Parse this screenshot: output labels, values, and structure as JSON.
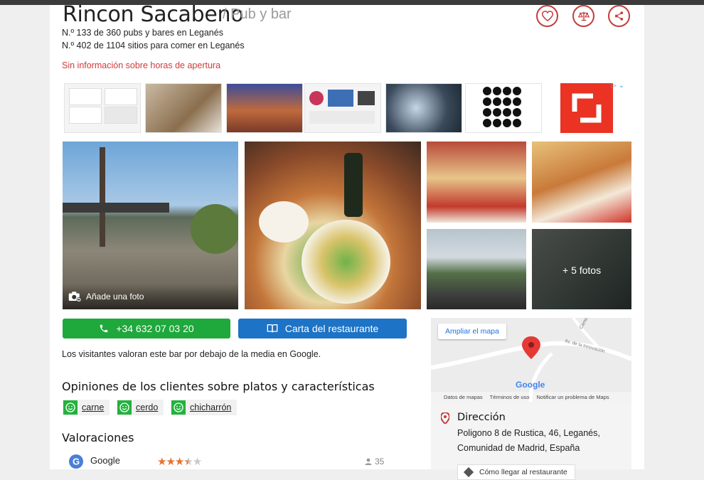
{
  "place": {
    "name": "Rincon Sacabeno",
    "category": "/ Pub y bar",
    "rank_pubs": "N.º 133 de 360 pubs y bares en Leganés",
    "rank_eat": "N.º 402 de 1104 sitios para comer en Leganés",
    "hours_notice": "Sin información sobre horas de apertura"
  },
  "actions": {
    "favorite_icon": "heart-icon",
    "compare_icon": "scale-icon",
    "share_icon": "share-icon"
  },
  "photos": {
    "add_photo": "Añade una foto",
    "more_photos": "+ 5 fotos"
  },
  "buttons": {
    "phone": "+34 632 07 03 20",
    "menu": "Carta del restaurante"
  },
  "visitors_text": "Los visitantes valoran este bar por debajo de la media en Google.",
  "opinions": {
    "heading": "Opiniones de los clientes sobre platos y características",
    "tags": [
      "carne",
      "cerdo",
      "chicharrón"
    ]
  },
  "ratings": {
    "heading": "Valoraciones",
    "rows": [
      {
        "source": "Google",
        "stars": 3.5,
        "count": "35"
      }
    ]
  },
  "map": {
    "enlarge": "Ampliar el mapa",
    "street": "Av. de la Innovación",
    "street2": "Camino",
    "brand": "Google",
    "footer": [
      "Datos de mapas",
      "Términos de uso",
      "Notificar un problema de Maps"
    ]
  },
  "address": {
    "title": "Dirección",
    "line1": "Poligono 8 de Rustica, 46, Leganés,",
    "line2": "Comunidad de Madrid, España",
    "directions": "Cómo llegar al restaurante"
  },
  "colors": {
    "accent_red": "#c43c3c",
    "green": "#1fa83b",
    "blue": "#1d73c5"
  }
}
